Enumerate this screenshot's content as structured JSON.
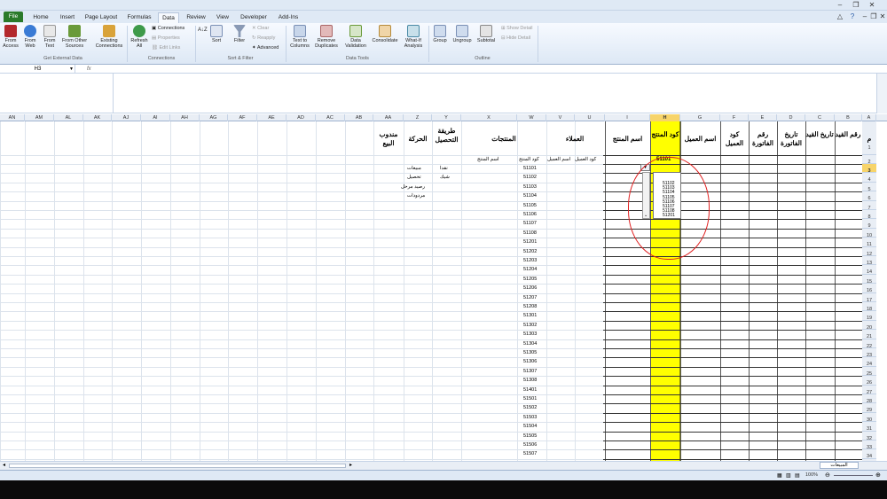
{
  "tabs": [
    "File",
    "Home",
    "Insert",
    "Page Layout",
    "Formulas",
    "Data",
    "Review",
    "View",
    "Developer",
    "Add-Ins"
  ],
  "ribbon": {
    "get_external": [
      "From Access",
      "From Web",
      "From Text",
      "From Other Sources",
      "Existing Connections"
    ],
    "get_external_group": "Get External Data",
    "refresh": "Refresh All",
    "connections": [
      "Connections",
      "Properties",
      "Edit Links"
    ],
    "connections_group": "Connections",
    "sort_az": "A↓Z",
    "sort": "Sort",
    "filter": "Filter",
    "filter_small": [
      "Clear",
      "Reapply",
      "Advanced"
    ],
    "sortfilter_group": "Sort & Filter",
    "tools": [
      "Text to Columns",
      "Remove Duplicates",
      "Data Validation",
      "Consolidate",
      "What-If Analysis"
    ],
    "tools_group": "Data Tools",
    "outline": [
      "Group",
      "Ungroup",
      "Subtotal"
    ],
    "outline_small": [
      "Show Detail",
      "Hide Detail"
    ],
    "outline_group": "Outline"
  },
  "namebox": "H3",
  "fx": "fx",
  "columns": [
    "A",
    "B",
    "C",
    "D",
    "E",
    "F",
    "G",
    "H",
    "I",
    "U",
    "V",
    "W",
    "X",
    "Y",
    "Z",
    "AA",
    "AB",
    "AC",
    "AD",
    "AE",
    "AF",
    "AG",
    "AH",
    "AI",
    "AJ",
    "AK",
    "AL",
    "AM",
    "AN"
  ],
  "headers": {
    "m": "م",
    "qayd_no": "رقم القيد",
    "qayd_date": "تاريخ القيد",
    "inv_date": "تاريخ الفاتورة",
    "inv_no": "رقم الفاتورة",
    "cust_code": "كود العميل",
    "cust_name": "اسم العميل",
    "prod_code": "كود المنتج",
    "prod_name": "اسم المنتج",
    "clients": "العملاء",
    "products": "المنتجات",
    "payment": "طريقة التحصيل",
    "movement": "الحركة",
    "rep": "مندوب البيع"
  },
  "row2": {
    "h": "51101",
    "cust_code": "كود العميل",
    "cust_name": "اسم العميل",
    "prod_code": "كود المنتج",
    "prod_name": "اسم المنتج"
  },
  "payment_list": [
    "نقدا",
    "شيك"
  ],
  "movement_list": [
    "مبيعات",
    "تحصيل",
    "رصيد مرحل",
    "مردودات"
  ],
  "product_codes": [
    "51101",
    "51102",
    "51103",
    "51104",
    "51105",
    "51106",
    "51107",
    "51108",
    "51201",
    "51202",
    "51203",
    "51204",
    "51205",
    "51206",
    "51207",
    "51208",
    "51301",
    "51302",
    "51303",
    "51304",
    "51305",
    "51306",
    "51307",
    "51308",
    "51401",
    "51501",
    "51502",
    "51503",
    "51504",
    "51505",
    "51506",
    "51507"
  ],
  "dropdown": [
    "51102",
    "51103",
    "51104",
    "51105",
    "51106",
    "51107",
    "51108",
    "51201"
  ],
  "sheet": "المبيعات",
  "zoom": "100%",
  "colors": {
    "highlight": "#ffff00",
    "circle": "#e02020",
    "file_tab": "#2a7a2a"
  }
}
